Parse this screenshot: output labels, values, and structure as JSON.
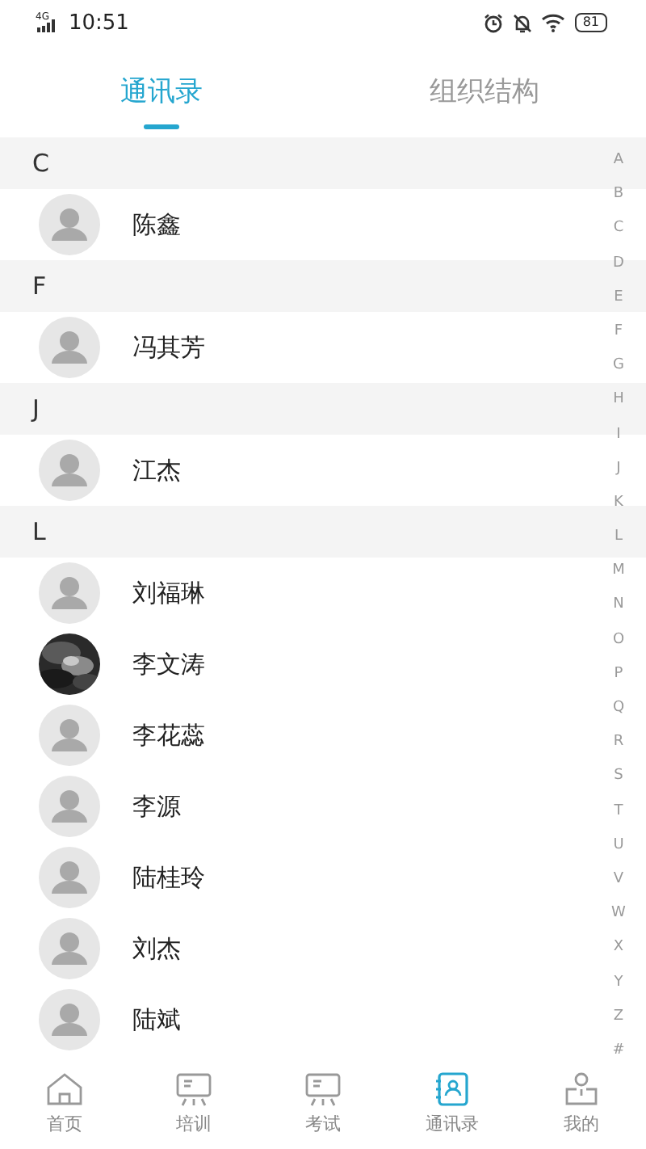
{
  "status_bar": {
    "network": "4G",
    "time": "10:51",
    "battery": "81"
  },
  "tabs": [
    {
      "label": "通讯录",
      "selected": true
    },
    {
      "label": "组织结构",
      "selected": false
    }
  ],
  "sections": [
    {
      "letter": "C",
      "contacts": [
        {
          "name": "陈鑫",
          "kind": "placeholder"
        }
      ]
    },
    {
      "letter": "F",
      "contacts": [
        {
          "name": "冯其芳",
          "kind": "placeholder"
        }
      ]
    },
    {
      "letter": "J",
      "contacts": [
        {
          "name": "江杰",
          "kind": "placeholder"
        }
      ]
    },
    {
      "letter": "L",
      "contacts": [
        {
          "name": "刘福琳",
          "kind": "placeholder"
        },
        {
          "name": "李文涛",
          "kind": "picture"
        },
        {
          "name": "李花蕊",
          "kind": "placeholder"
        },
        {
          "name": "李源",
          "kind": "placeholder"
        },
        {
          "name": "陆桂玲",
          "kind": "placeholder"
        },
        {
          "name": "刘杰",
          "kind": "placeholder"
        },
        {
          "name": "陆斌",
          "kind": "placeholder"
        }
      ]
    }
  ],
  "index_letters": [
    "A",
    "B",
    "C",
    "D",
    "E",
    "F",
    "G",
    "H",
    "I",
    "J",
    "K",
    "L",
    "M",
    "N",
    "O",
    "P",
    "Q",
    "R",
    "S",
    "T",
    "U",
    "V",
    "W",
    "X",
    "Y",
    "Z",
    "#"
  ],
  "nav": [
    {
      "label": "首页",
      "selected": false
    },
    {
      "label": "培训",
      "selected": false
    },
    {
      "label": "考试",
      "selected": false
    },
    {
      "label": "通讯录",
      "selected": true
    },
    {
      "label": "我的",
      "selected": false
    }
  ]
}
